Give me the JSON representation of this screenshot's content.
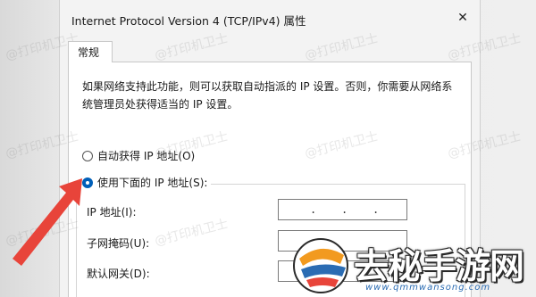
{
  "dialog": {
    "title": "Internet Protocol Version 4 (TCP/IPv4) 属性",
    "close_glyph": "✕"
  },
  "tabs": [
    {
      "label": "常规",
      "active": true
    }
  ],
  "general": {
    "description": "如果网络支持此功能，则可以获取自动指派的 IP 设置。否则，你需要从网络系统管理员处获得适当的 IP 设置。",
    "radio_auto": {
      "label": "自动获得 IP 地址(O)",
      "checked": false
    },
    "radio_manual": {
      "label": "使用下面的 IP 地址(S):",
      "checked": true
    },
    "fields": {
      "ip_label": "IP 地址(I):",
      "subnet_label": "子网掩码(U):",
      "gateway_label": "默认网关(D):"
    },
    "ip_dot": "."
  },
  "overlay": {
    "watermark": "@打印机卫士",
    "logo_text": "去秘手游网",
    "logo_url": "www.qmmwansong.com",
    "arrow_color": "#e8443a",
    "accent": "#005fb8"
  }
}
